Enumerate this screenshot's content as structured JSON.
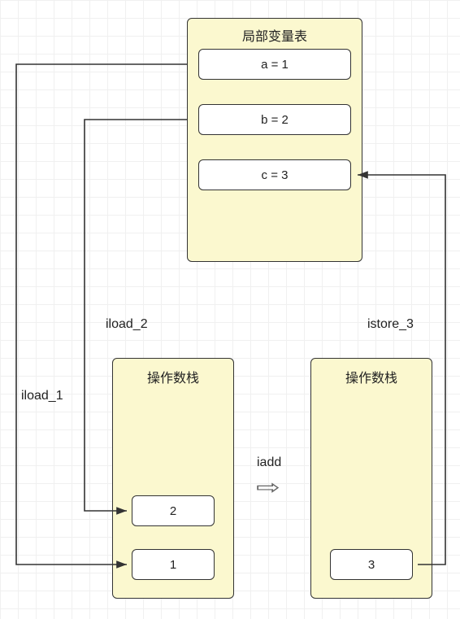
{
  "chart_data": {
    "type": "diagram",
    "title": "",
    "boxes": {
      "local_var_table": {
        "title": "局部变量表",
        "entries": [
          "a = 1",
          "b = 2",
          "c = 3"
        ]
      },
      "operand_stack_left": {
        "title": "操作数栈",
        "entries": [
          "2",
          "1"
        ]
      },
      "operand_stack_right": {
        "title": "操作数栈",
        "entries": [
          "3"
        ]
      }
    },
    "edges": [
      {
        "label": "iload_1",
        "from": "local_var_table.a",
        "to": "operand_stack_left.1"
      },
      {
        "label": "iload_2",
        "from": "local_var_table.b",
        "to": "operand_stack_left.2"
      },
      {
        "label": "iadd",
        "from": "operand_stack_left",
        "to": "operand_stack_right"
      },
      {
        "label": "istore_3",
        "from": "operand_stack_right.3",
        "to": "local_var_table.c"
      }
    ]
  },
  "labels": {
    "iload1": "iload_1",
    "iload2": "iload_2",
    "iadd": "iadd",
    "istore3": "istore_3"
  }
}
